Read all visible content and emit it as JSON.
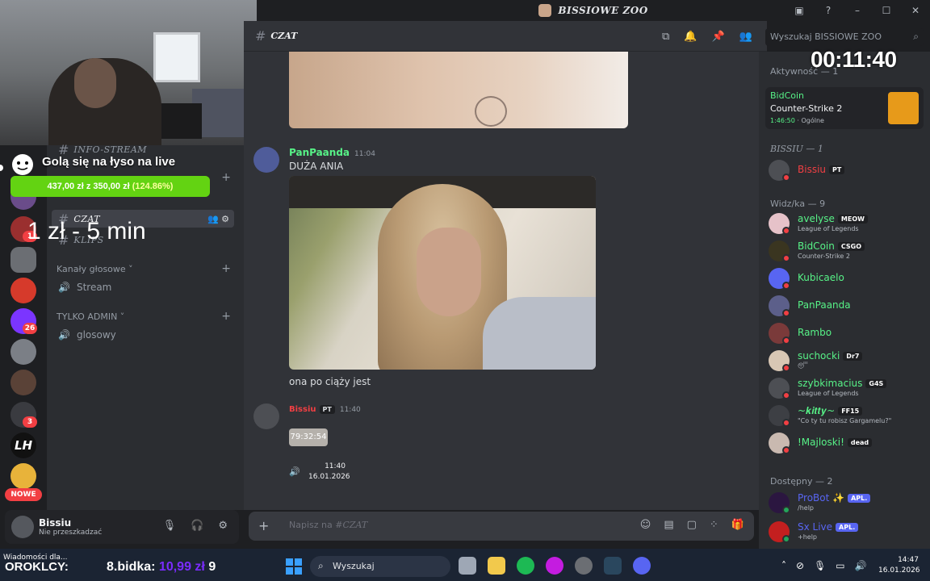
{
  "window": {
    "title": "BISSIOWE ZOO",
    "controls": [
      "–",
      "☐",
      "✕"
    ]
  },
  "overlay": {
    "goal_title": "Golą się na łyso na live",
    "goal_current": "437,00 zł",
    "goal_separator": "z",
    "goal_target": "350,00 zł",
    "goal_percent": "(124.86%)",
    "goal_progress": 1.0,
    "rate_text": "1 zł - 5 min",
    "timer": "00:11:40"
  },
  "channels": {
    "info_stream": "INFO-STREAM",
    "czat": "CZAT",
    "klips": "KLIPS",
    "voice_category": "Kanały głosowe",
    "voice_channel": "Stream",
    "admin_category": "TYLKO ADMIN",
    "admin_channel": "glosowy"
  },
  "servers": {
    "badges": [
      "1",
      "26",
      "3"
    ],
    "lh": "LH",
    "nowe": "NOWE"
  },
  "user_panel": {
    "name": "Bissiu",
    "status": "Nie przeszkadzać"
  },
  "chat_header": {
    "channel": "CZAT",
    "search_placeholder": "Wyszukaj BISSIOWE ZOO"
  },
  "messages": [
    {
      "author": "PanPaanda",
      "time": "11:04",
      "text": "DUŻA ANIA",
      "after_text": "ona po ciąży jest",
      "author_color": "#57f287"
    },
    {
      "author": "Bissiu",
      "badge": "PT",
      "time": "11:40",
      "chip": "79:32:54",
      "embed_time": "11:40",
      "embed_date": "16.01.2026",
      "author_color": "#f23f43"
    }
  ],
  "input": {
    "placeholder_prefix": "Napisz na #",
    "placeholder_channel": "CZAT"
  },
  "members": {
    "activity_header": "Aktywność — 1",
    "activity_user": "BidCoin",
    "activity_game": "Counter-Strike 2",
    "activity_time": "1:46:50",
    "activity_channel": "Ogólne",
    "bissiu_header": "BISSIU — 1",
    "bissiu_name": "Bissiu",
    "bissiu_tag": "PT",
    "widz_header": "Widz/ka — 9",
    "widz": [
      {
        "name": "avelyse",
        "tag": "MEOW",
        "sub": "League of Legends",
        "color": "#57f287",
        "av": "#e6c2c9"
      },
      {
        "name": "BidCoin",
        "tag": "CSGO",
        "sub": "Counter-Strike 2",
        "color": "#57f287",
        "av": "#3a3520"
      },
      {
        "name": "Kubicaelo",
        "tag": "",
        "sub": "",
        "color": "#57f287",
        "av": "#5865f2"
      },
      {
        "name": "PanPaanda",
        "tag": "",
        "sub": "",
        "color": "#57f287",
        "av": "#5c5f8a"
      },
      {
        "name": "Rambo",
        "tag": "",
        "sub": "",
        "color": "#57f287",
        "av": "#7a3a3a"
      },
      {
        "name": "suchocki",
        "tag": "Dr7",
        "sub": "😴",
        "color": "#57f287",
        "av": "#d8c7b4"
      },
      {
        "name": "szybkimacius",
        "tag": "G4S",
        "sub": "League of Legends",
        "color": "#57f287",
        "av": "#4d4f54"
      },
      {
        "name": "~𝒌𝒊𝒕𝒕𝒚~",
        "tag": "FF15",
        "sub": "\"Co ty tu robisz Gargamelu?\"",
        "color": "#57f287",
        "av": "#3d3f44"
      },
      {
        "name": "!Majloski!",
        "tag": "dead",
        "sub": "",
        "color": "#57f287",
        "av": "#c9b9b0"
      }
    ],
    "dostepny_header": "Dostępny — 2",
    "bots": [
      {
        "name": "ProBot ✨",
        "tag": "APL.",
        "sub": "/help",
        "color": "#5865f2",
        "av": "#2b1640"
      },
      {
        "name": "Sx Live",
        "tag": "APL.",
        "sub": "+help",
        "color": "#5865f2",
        "av": "#c31f1f"
      }
    ]
  },
  "taskbar": {
    "notif": "Wiadomości dla...",
    "orok_label": "OROKLCY:",
    "orok_value": "",
    "bid_label": "8.bidka:",
    "bid_value": "10,99 zł",
    "bid_extra": "9",
    "search": "Wyszukaj",
    "time": "14:47",
    "date": "16.01.2026"
  },
  "colors": {
    "accent": "#5865f2",
    "green": "#57f287",
    "red": "#f23f43",
    "goal_green": "#63d312"
  }
}
